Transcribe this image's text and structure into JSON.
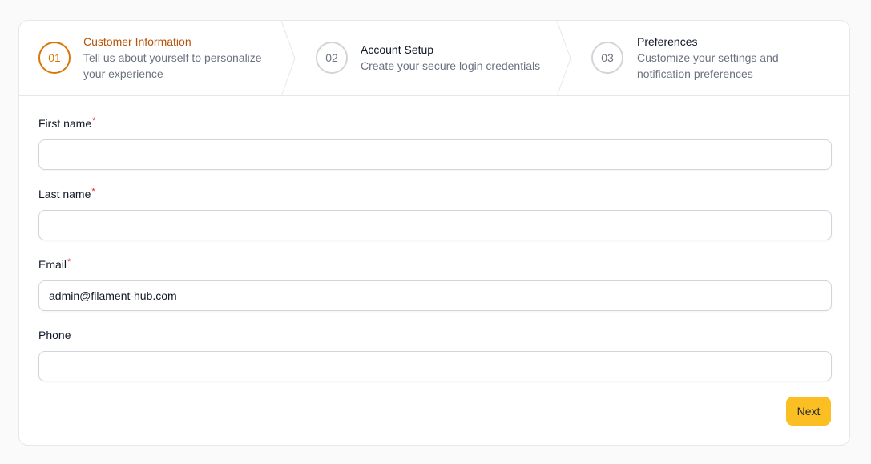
{
  "steps": [
    {
      "number": "01",
      "title": "Customer Information",
      "desc_line1": "Tell us about yourself to personalize",
      "desc_line2": "your experience",
      "active": true
    },
    {
      "number": "02",
      "title": "Account Setup",
      "desc_line1": "Create your secure login credentials",
      "active": false
    },
    {
      "number": "03",
      "title": "Preferences",
      "desc_line1": "Customize your settings and",
      "desc_line2": "notification preferences",
      "active": false
    }
  ],
  "form": {
    "first_name": {
      "label": "First name",
      "required_mark": "*",
      "value": ""
    },
    "last_name": {
      "label": "Last name",
      "required_mark": "*",
      "value": ""
    },
    "email": {
      "label": "Email",
      "required_mark": "*",
      "value": "admin@filament-hub.com"
    },
    "phone": {
      "label": "Phone",
      "value": ""
    }
  },
  "actions": {
    "next_label": "Next"
  },
  "colors": {
    "accent": "#d97706",
    "button": "#fbbf24",
    "required": "#dc2626"
  }
}
